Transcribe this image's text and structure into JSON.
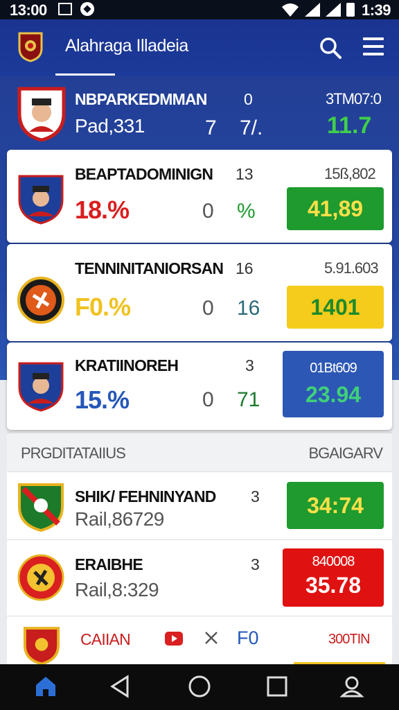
{
  "status_bar": {
    "time": "13:00",
    "clock_right": "1:39"
  },
  "app": {
    "title": "Alahraga Illadeia"
  },
  "featured": {
    "name": "NBPARKEDMMAN",
    "sub": "Pad,331",
    "n1": "0",
    "n2": "7",
    "n3": "7/.",
    "code": "3TM07:0",
    "value": "11.7"
  },
  "cards": [
    {
      "name": "BEAPTADOMINIGN",
      "count": "13",
      "code": "15ß,802",
      "pct": "18.%",
      "mid1": "0",
      "mid2": "%",
      "box": "41,89"
    },
    {
      "name": "TENNINITANIORSAN",
      "count": "16",
      "code": "5.91.603",
      "pct": "F0.%",
      "mid1": "0",
      "mid2": "16",
      "box": "1401"
    },
    {
      "name": "KRATIINOREH",
      "count": "3",
      "code": "01Bt609",
      "pct": "15.%",
      "mid1": "0",
      "mid2": "71",
      "box": "23.94"
    }
  ],
  "section": {
    "left": "PRGDITATAIIUS",
    "right": "BGAIGARV"
  },
  "rows": [
    {
      "name": "SHIK/ FEHNINYAND",
      "count": "3",
      "sub": "Rail,86729",
      "box_value": "34:74"
    },
    {
      "name": "ERAIBHE",
      "count": "3",
      "sub": "Rail,8:329",
      "box_top": "840008",
      "box_value": "35.78"
    },
    {
      "name": "CAIIAN",
      "mid": "F0",
      "right": "300TIN"
    }
  ],
  "colors": {
    "header_blue": "#1c3a9a",
    "accent_green": "#1e9a2e",
    "accent_yellow": "#f5cc1c",
    "accent_blue": "#2d57b4",
    "accent_red": "#e01111"
  }
}
